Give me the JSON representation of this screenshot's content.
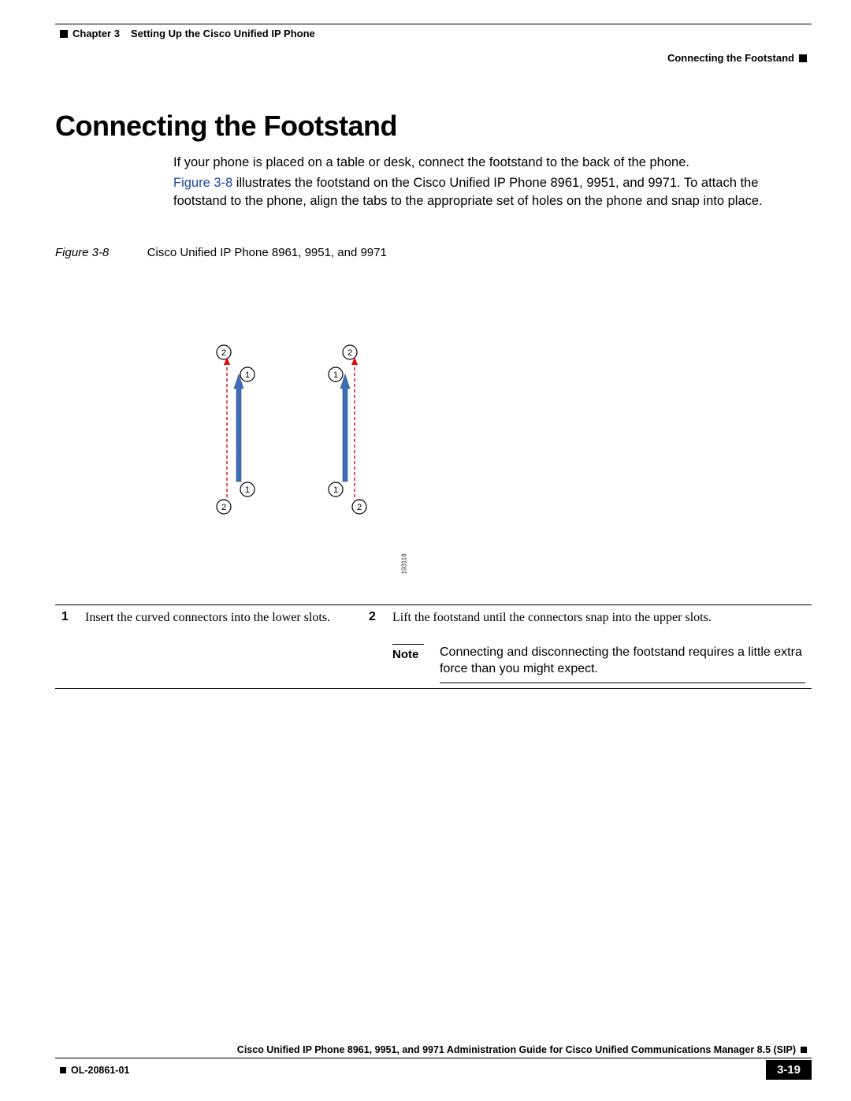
{
  "header": {
    "chapter_label": "Chapter 3",
    "chapter_title": "Setting Up the Cisco Unified IP Phone",
    "section_title": "Connecting the Footstand"
  },
  "main": {
    "heading": "Connecting the Footstand",
    "para1": "If your phone is placed on a table or desk, connect the footstand to the back of the phone.",
    "figure_link": "Figure 3-8",
    "para2a": " illustrates the footstand on the Cisco Unified IP Phone 8961, 9951, and 9971. To attach the footstand to the phone, align the tabs to the appropriate set of holes on the phone and snap into place."
  },
  "figure": {
    "label": "Figure 3-8",
    "caption": "Cisco Unified IP Phone 8961, 9951, and 9971",
    "id": "193118"
  },
  "callouts": {
    "row1_num": "1",
    "row1_text": "Insert the curved connectors into the lower slots.",
    "row2_num": "2",
    "row2_text": "Lift the footstand until the connectors snap into the upper slots.",
    "note_label": "Note",
    "note_text": "Connecting and disconnecting the footstand requires a little extra force than you might expect."
  },
  "footer": {
    "guide_title": "Cisco Unified IP Phone 8961, 9951, and 9971 Administration Guide for Cisco Unified Communications Manager 8.5 (SIP)",
    "doc_id": "OL-20861-01",
    "page_num": "3-19"
  }
}
